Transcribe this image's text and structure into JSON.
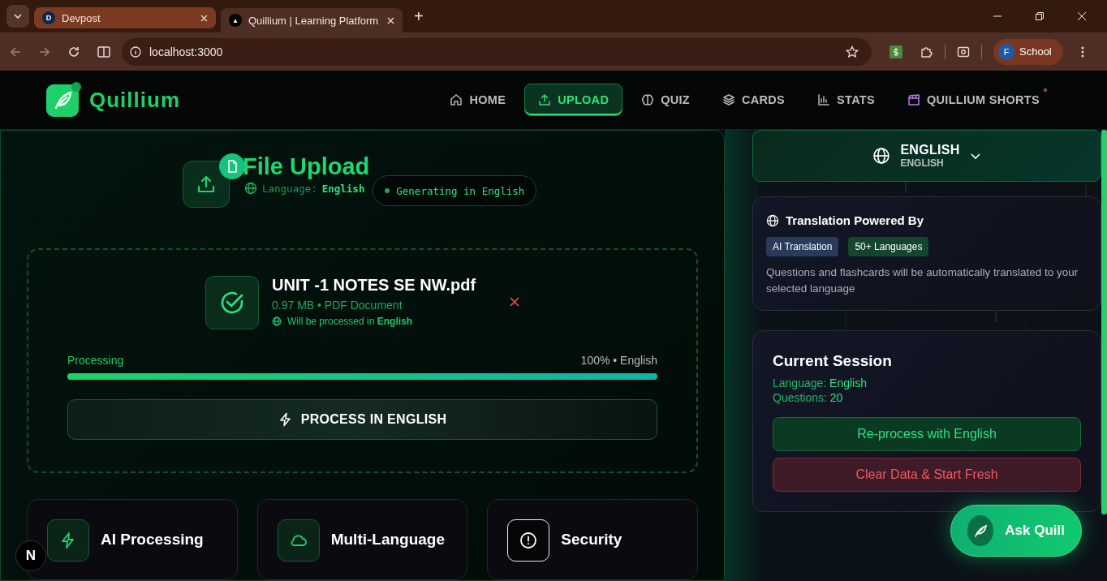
{
  "browser": {
    "tabs": [
      {
        "title": "Devpost",
        "favicon": "D",
        "selected": false
      },
      {
        "title": "Quillium | Learning Platform",
        "favicon": "▲",
        "selected": true
      }
    ],
    "new_tab": "+",
    "address": "localhost:3000",
    "profile": {
      "initial": "F",
      "name": "School"
    }
  },
  "header": {
    "brand": "Quillium",
    "nav": [
      {
        "label": "HOME",
        "selected": false
      },
      {
        "label": "UPLOAD",
        "selected": true
      },
      {
        "label": "QUIZ",
        "selected": false
      },
      {
        "label": "CARDS",
        "selected": false
      },
      {
        "label": "STATS",
        "selected": false
      },
      {
        "label": "QUILLIUM SHORTS",
        "selected": false
      }
    ]
  },
  "upload": {
    "title": "File Upload",
    "language_label": "Language:",
    "language_value": "English",
    "status_chip": "Generating in English"
  },
  "file": {
    "name": "UNIT -1 NOTES SE NW.pdf",
    "meta": "0.97 MB • PDF Document",
    "note": "Will be processed in **English**",
    "progress": {
      "label": "Processing",
      "reading": "100% • English",
      "level": 1
    },
    "process_button": "PROCESS IN ENGLISH"
  },
  "features": [
    {
      "title": "AI Processing"
    },
    {
      "title": "Multi-Language"
    },
    {
      "title": "Security"
    }
  ],
  "language_selector": {
    "name": "ENGLISH",
    "native": "ENGLISH"
  },
  "translation": {
    "title": "Translation Powered By",
    "tags": [
      {
        "label": "AI Translation",
        "color": "#2a3a5c"
      },
      {
        "label": "50+ Languages",
        "color": "#14452f"
      }
    ],
    "description": "Questions and flashcards will be automatically translated to your selected language"
  },
  "session": {
    "title": "Current Session",
    "lines": [
      {
        "label": "Language:",
        "value": "English"
      },
      {
        "label": "Questions:",
        "value": "20"
      }
    ],
    "buttons": [
      {
        "label": "Re-process with English",
        "kind": "primary"
      },
      {
        "label": "Clear Data & Start Fresh",
        "kind": "danger"
      }
    ]
  },
  "ask_button": "Ask Quill",
  "dev_badge": "N"
}
